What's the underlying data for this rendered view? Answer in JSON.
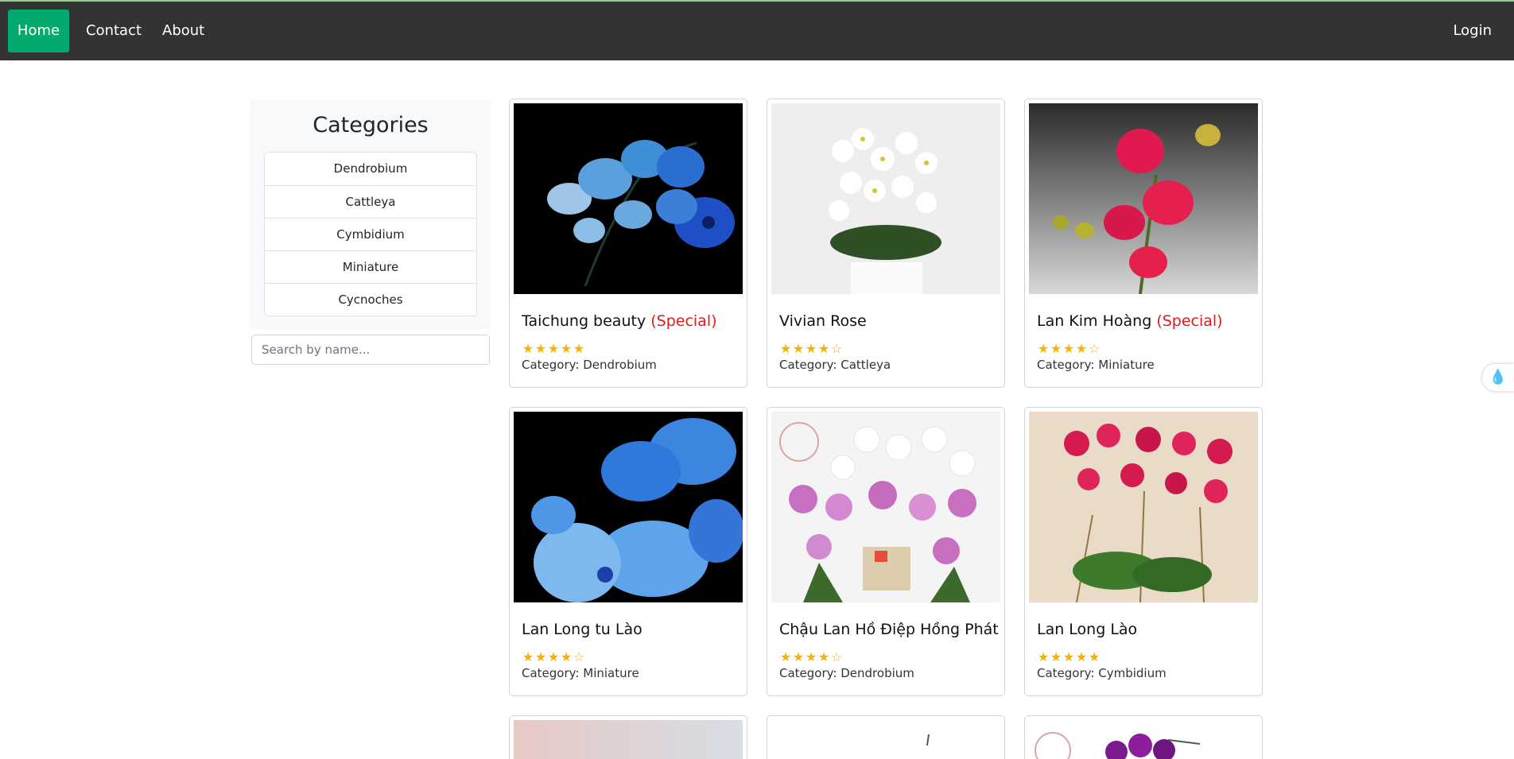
{
  "nav": {
    "home": "Home",
    "contact": "Contact",
    "about": "About",
    "login": "Login"
  },
  "sidebar": {
    "title": "Categories",
    "items": [
      "Dendrobium",
      "Cattleya",
      "Cymbidium",
      "Miniature",
      "Cycnoches"
    ],
    "search_placeholder": "Search by name..."
  },
  "products": [
    {
      "name": "Taichung beauty",
      "special": "(Special)",
      "rating": 5,
      "category": "Category: Dendrobium",
      "image": "blue orchid on black"
    },
    {
      "name": "Vivian Rose",
      "special": "",
      "rating": 4.5,
      "category": "Category: Cattleya",
      "image": "white orchids in pot"
    },
    {
      "name": "Lan Kim Hoàng",
      "special": "(Special)",
      "rating": 4.5,
      "category": "Category: Miniature",
      "image": "red spotted orchid"
    },
    {
      "name": "Lan Long tu Lào",
      "special": "",
      "rating": 4.5,
      "category": "Category: Miniature",
      "image": "blue orchid close-up"
    },
    {
      "name": "Chậu Lan Hồ Điệp Hồng Phát",
      "special": "",
      "rating": 4.5,
      "category": "Category: Dendrobium",
      "image": "pink and white orchids"
    },
    {
      "name": "Lan Long Lào",
      "special": "",
      "rating": 5,
      "category": "Category: Cymbidium",
      "image": "magenta orchids in pot"
    }
  ],
  "colors": {
    "navbar": "#333333",
    "accent": "#04aa6d",
    "special": "#e01b1b",
    "star": "#f5b301"
  },
  "icons": {
    "floating_button": "water-drop-icon"
  }
}
